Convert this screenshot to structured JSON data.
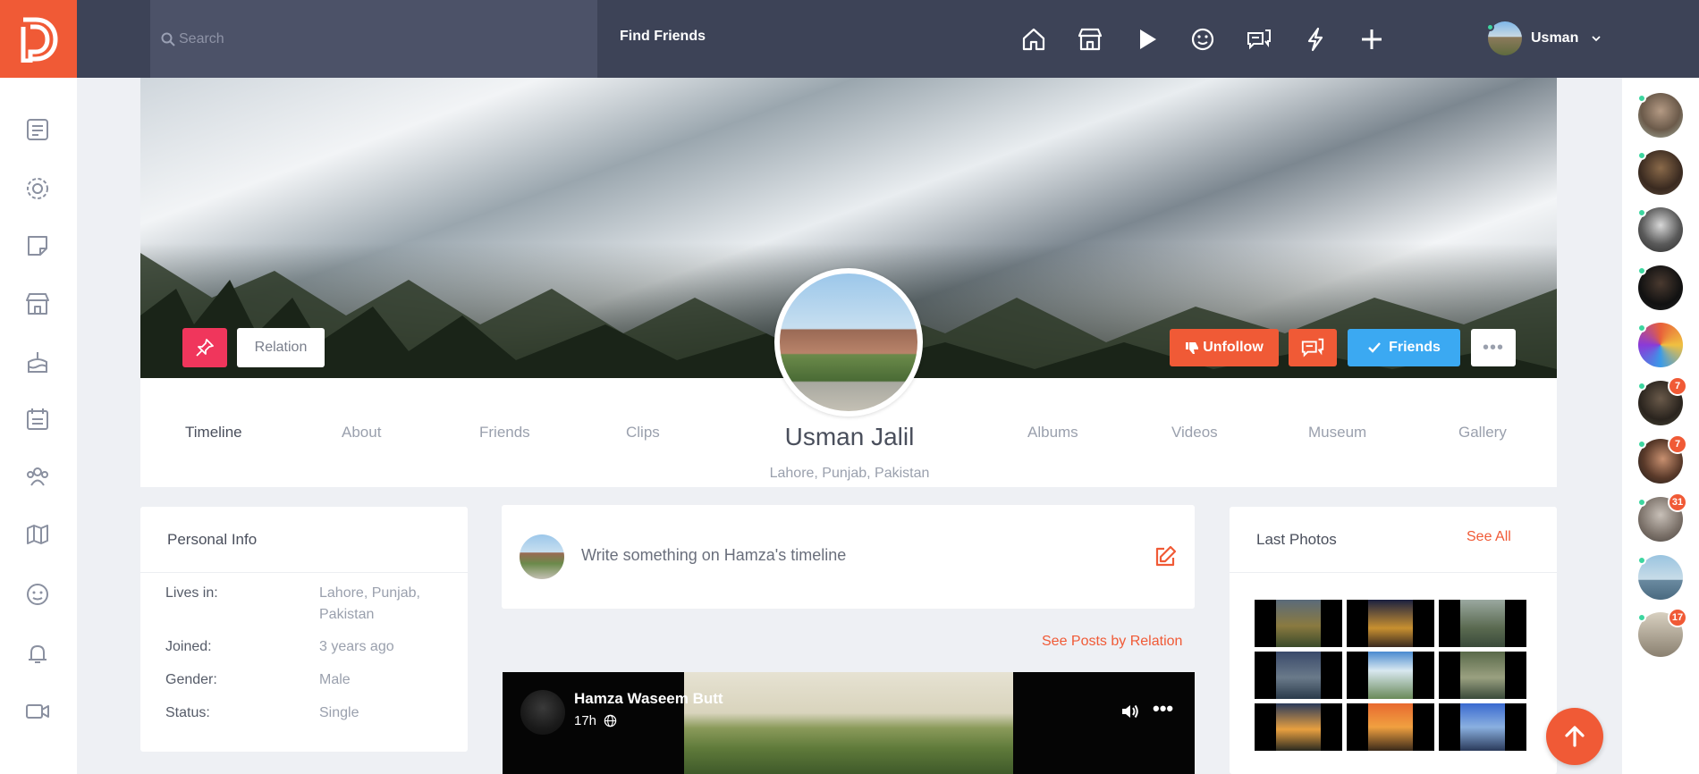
{
  "topbar": {
    "search_placeholder": "Search",
    "find_friends": "Find Friends",
    "user_name": "Usman"
  },
  "profile": {
    "name": "Usman Jalil",
    "location": "Lahore, Punjab, Pakistan",
    "relation_label": "Relation",
    "unfollow_label": "Unfollow",
    "friends_label": "Friends",
    "more_label": "•••"
  },
  "tabs": [
    "Timeline",
    "About",
    "Friends",
    "Clips",
    "Albums",
    "Videos",
    "Museum",
    "Gallery"
  ],
  "personal_info": {
    "title": "Personal Info",
    "rows": [
      {
        "label": "Lives in:",
        "value": "Lahore, Punjab, Pakistan"
      },
      {
        "label": "Joined:",
        "value": "3 years ago"
      },
      {
        "label": "Gender:",
        "value": "Male"
      },
      {
        "label": "Status:",
        "value": "Single"
      }
    ]
  },
  "composer": {
    "placeholder": "Write something on Hamza's timeline"
  },
  "see_posts": "See Posts by Relation",
  "post": {
    "author": "Hamza Waseem Butt",
    "time": "17h",
    "more": "•••"
  },
  "last_photos": {
    "title": "Last Photos",
    "see_all": "See All"
  },
  "right_sidebar": {
    "badges": [
      "7",
      "7",
      "31",
      "17"
    ]
  },
  "colors": {
    "brand": "#f05a36",
    "topbar": "#3d4357",
    "friends_blue": "#3ba9f2",
    "pin_red": "#f0365c",
    "online_green": "#3dd6a0"
  },
  "icons": {
    "top": [
      "home-icon",
      "store-icon",
      "play-icon",
      "smile-icon",
      "chat-icon",
      "flash-icon",
      "plus-icon"
    ],
    "left": [
      "feed-icon",
      "settings-icon",
      "sticky-note-icon",
      "store-icon",
      "cake-icon",
      "calendar-icon",
      "groups-icon",
      "map-icon",
      "face-icon",
      "bell-icon",
      "video-icon"
    ]
  }
}
